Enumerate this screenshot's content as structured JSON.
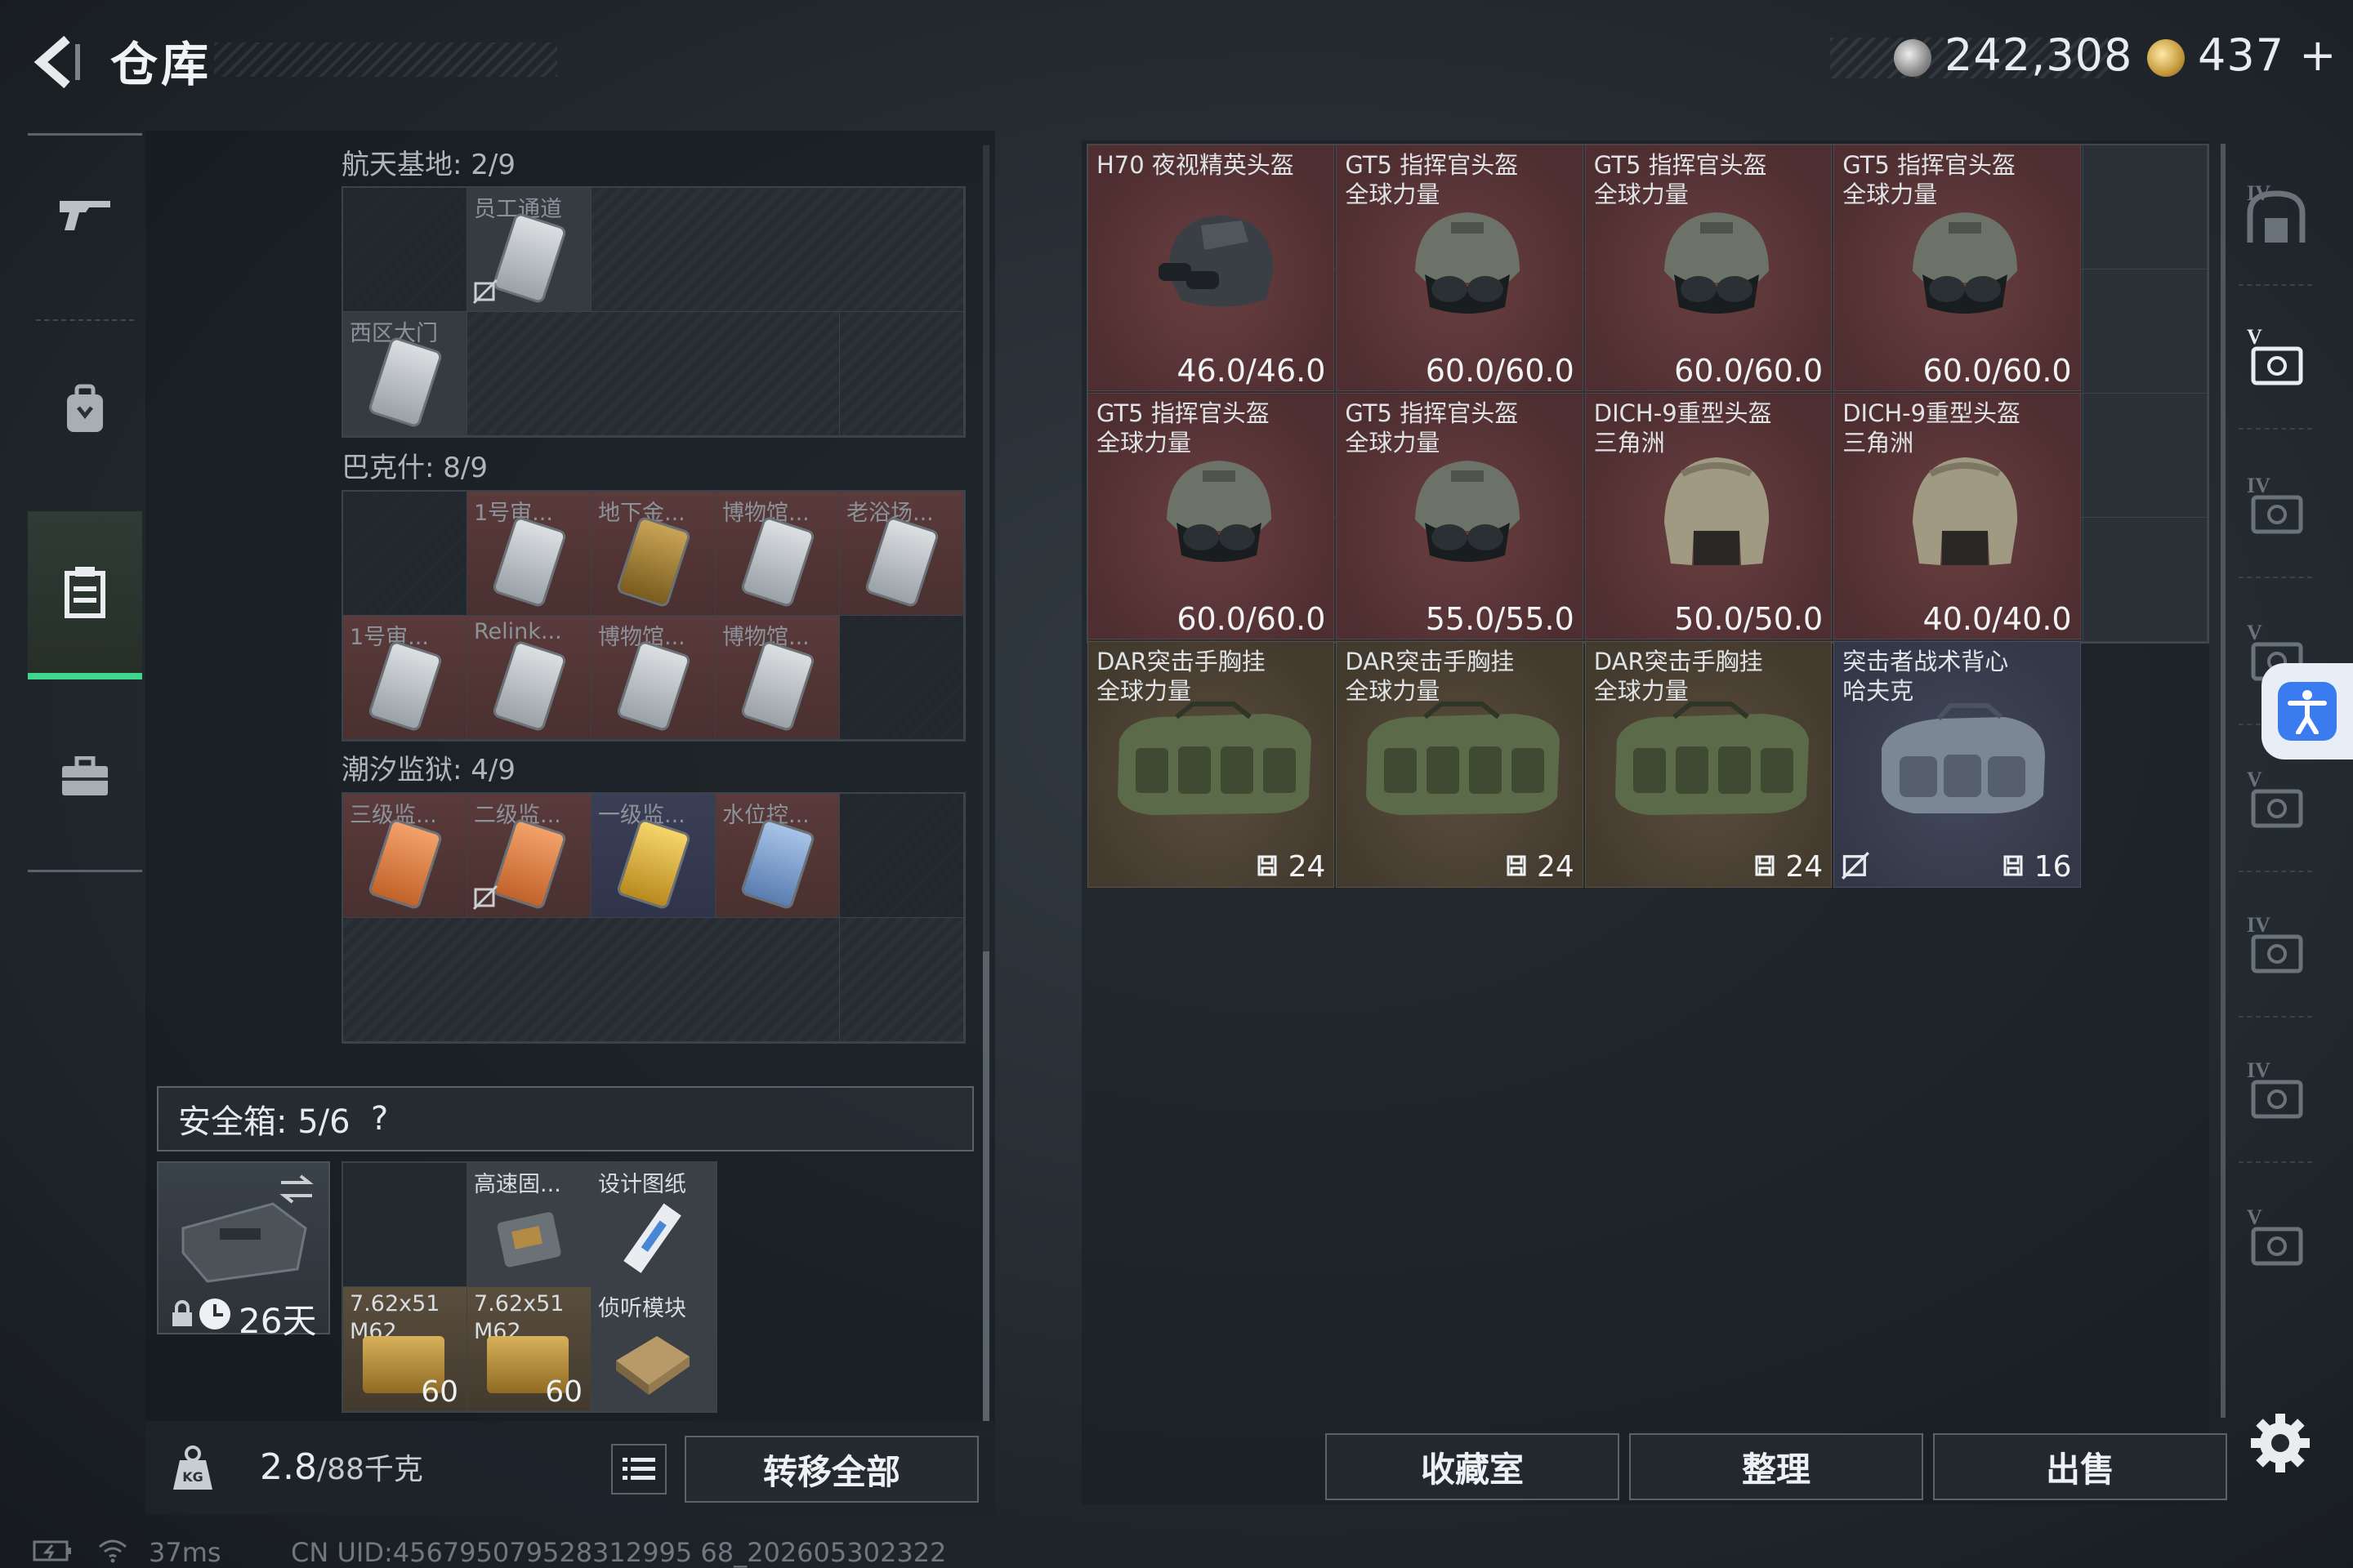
{
  "header": {
    "title": "仓库",
    "currency1": "242,308",
    "currency2": "437",
    "add_symbol": "+"
  },
  "left_nav": [
    "gun-icon",
    "backpack-icon",
    "storage-icon",
    "briefcase-icon"
  ],
  "sections": [
    {
      "title": "航天基地: 2/9",
      "cells": [
        {
          "label": "",
          "type": "empty"
        },
        {
          "label": "员工通道",
          "type": "card",
          "locked": true
        },
        {
          "label": "",
          "type": "empty"
        },
        {
          "label": "西区大门",
          "type": "card"
        }
      ]
    },
    {
      "title": "巴克什: 8/9",
      "cells": [
        {
          "label": "",
          "type": "empty"
        },
        {
          "label": "1号审...",
          "type": "card"
        },
        {
          "label": "地下金...",
          "type": "key"
        },
        {
          "label": "博物馆...",
          "type": "card"
        },
        {
          "label": "老浴场...",
          "type": "card"
        },
        {
          "label": "1号审...",
          "type": "card"
        },
        {
          "label": "Relink...",
          "type": "card"
        },
        {
          "label": "博物馆...",
          "type": "card"
        },
        {
          "label": "博物馆...",
          "type": "card"
        }
      ]
    },
    {
      "title": "潮汐监狱: 4/9",
      "cells": [
        {
          "label": "三级监...",
          "type": "orange"
        },
        {
          "label": "二级监...",
          "type": "orange",
          "locked": true
        },
        {
          "label": "一级监...",
          "type": "yellow"
        },
        {
          "label": "水位控...",
          "type": "blue"
        }
      ]
    }
  ],
  "safe": {
    "header": "安全箱:  5/6",
    "help": "?",
    "timer": "26天",
    "items": [
      {
        "label": "高速固...",
        "count": ""
      },
      {
        "label": "设计图纸",
        "count": ""
      },
      {
        "label": "7.62x51 M62",
        "count": "60"
      },
      {
        "label": "7.62x51 M62",
        "count": "60"
      },
      {
        "label": "侦听模块",
        "count": ""
      }
    ]
  },
  "weight": {
    "value": "2.8",
    "max": "/88千克"
  },
  "buttons": {
    "transfer_all": "转移全部",
    "collection": "收藏室",
    "organize": "整理",
    "sell": "出售"
  },
  "stash_items": [
    {
      "line1": "H70 夜视精英头盔",
      "line2": "",
      "stat": "46.0/46.0",
      "kind": "helmet-nv",
      "color": "red"
    },
    {
      "line1": "GT5 指挥官头盔",
      "line2": "全球力量",
      "stat": "60.0/60.0",
      "kind": "helmet-gt5",
      "color": "red"
    },
    {
      "line1": "GT5 指挥官头盔",
      "line2": "全球力量",
      "stat": "60.0/60.0",
      "kind": "helmet-gt5",
      "color": "red"
    },
    {
      "line1": "GT5 指挥官头盔",
      "line2": "全球力量",
      "stat": "60.0/60.0",
      "kind": "helmet-gt5",
      "color": "red"
    },
    {
      "line1": "GT5 指挥官头盔",
      "line2": "全球力量",
      "stat": "60.0/60.0",
      "kind": "helmet-gt5",
      "color": "red"
    },
    {
      "line1": "GT5 指挥官头盔",
      "line2": "全球力量",
      "stat": "55.0/55.0",
      "kind": "helmet-gt5",
      "color": "red"
    },
    {
      "line1": "DICH-9重型头盔",
      "line2": "三角洲",
      "stat": "50.0/50.0",
      "kind": "helmet-dich",
      "color": "red"
    },
    {
      "line1": "DICH-9重型头盔",
      "line2": "三角洲",
      "stat": "40.0/40.0",
      "kind": "helmet-dich",
      "color": "red"
    },
    {
      "line1": "DAR突击手胸挂",
      "line2": "全球力量",
      "stat": "24",
      "kind": "rig-green",
      "color": "brown"
    },
    {
      "line1": "DAR突击手胸挂",
      "line2": "全球力量",
      "stat": "24",
      "kind": "rig-green",
      "color": "brown"
    },
    {
      "line1": "DAR突击手胸挂",
      "line2": "全球力量",
      "stat": "24",
      "kind": "rig-green",
      "color": "brown"
    },
    {
      "line1": "突击者战术背心",
      "line2": "哈夫克",
      "stat": "16",
      "kind": "rig-gray",
      "color": "blue",
      "locked": true
    }
  ],
  "right_nav": [
    "locker-icon",
    "tier-4-helmet-icon",
    "tier-5-gear-icon",
    "tier-4-armor-icon",
    "tier-5-rig-icon",
    "tier-4-rig-icon",
    "tier-4-bag-icon",
    "tier-4-case-icon"
  ],
  "right_nav_labels": [
    "IV",
    "V",
    "IV",
    "V",
    "V",
    "IV",
    "IV",
    "V"
  ],
  "status": {
    "ping": "37ms",
    "uid": "CN UID:456795079528312995 68_202605302322"
  }
}
